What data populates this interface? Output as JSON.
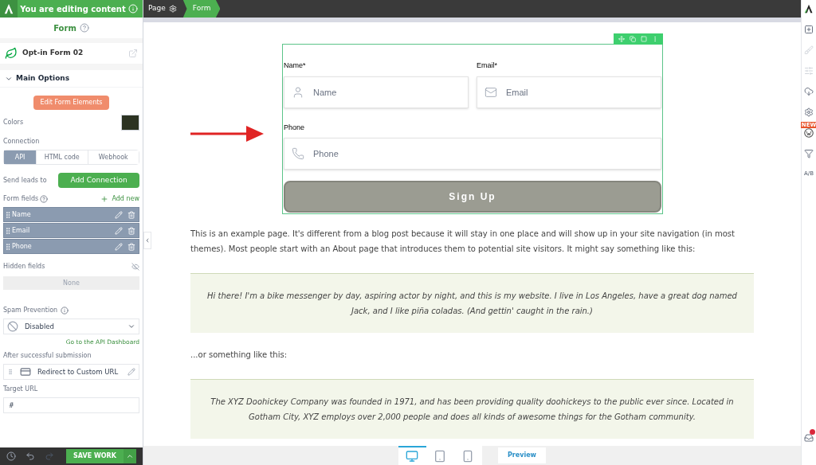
{
  "sidebar": {
    "banner": "You are editing content",
    "title": "Form",
    "element": {
      "name": "Opt-in Form 02"
    },
    "section": {
      "title": "Main Options",
      "expanded": true
    },
    "edit_button": "Edit Form Elements",
    "colors_label": "Colors",
    "color": "#2c3322",
    "connection_label": "Connection",
    "connection_tabs": [
      {
        "label": "API",
        "selected": true
      },
      {
        "label": "HTML code",
        "selected": false
      },
      {
        "label": "Webhook",
        "selected": false
      }
    ],
    "send_leads_label": "Send leads to",
    "add_connection": "Add Connection",
    "form_fields_label": "Form fields",
    "add_new": "Add new",
    "form_fields": [
      {
        "label": "Name"
      },
      {
        "label": "Email"
      },
      {
        "label": "Phone"
      }
    ],
    "hidden_fields_label": "Hidden fields",
    "hidden_fields_empty": "None",
    "spam_label": "Spam Prevention",
    "spam_value": "Disabled",
    "api_link": "Go to the API Dashboard",
    "after_label": "After successful submission",
    "after_value": "Redirect to Custom URL",
    "target_label": "Target URL",
    "target_value": "#",
    "save": "SAVE WORK"
  },
  "breadcrumb": [
    {
      "label": "Page",
      "selected": false
    },
    {
      "label": "Form",
      "selected": true
    }
  ],
  "form": {
    "fields": [
      {
        "label": "Name*",
        "placeholder": "Name",
        "kind": "person"
      },
      {
        "label": "Email*",
        "placeholder": "Email",
        "kind": "mail"
      },
      {
        "label": "Phone",
        "placeholder": "Phone",
        "kind": "phone"
      }
    ],
    "submit": "Sign Up"
  },
  "content": [
    {
      "kind": "paragraph",
      "text": "This is an example page. It's different from a blog post because it will stay in one place and will show up in your site navigation (in most themes). Most people start with an About page that introduces them to potential site visitors. It might say something like this:"
    },
    {
      "kind": "quote",
      "text": "Hi there! I'm a bike messenger by day, aspiring actor by night, and this is my website. I live in Los Angeles, have a great dog named Jack, and I like piña coladas. (And gettin' caught in the rain.)"
    },
    {
      "kind": "paragraph",
      "text": "...or something like this:"
    },
    {
      "kind": "quote",
      "text": "The XYZ Doohickey Company was founded in 1971, and has been providing quality doohickeys to the public ever since. Located in Gotham City, XYZ employs over 2,000 people and does all kinds of awesome things for the Gotham community."
    }
  ],
  "right_rail": {
    "new_badge": "NEW",
    "ab_label": "A/B"
  },
  "devices": [
    {
      "kind": "desktop",
      "selected": true
    },
    {
      "kind": "tablet",
      "selected": false
    },
    {
      "kind": "phone",
      "selected": false
    }
  ],
  "preview": "Preview"
}
